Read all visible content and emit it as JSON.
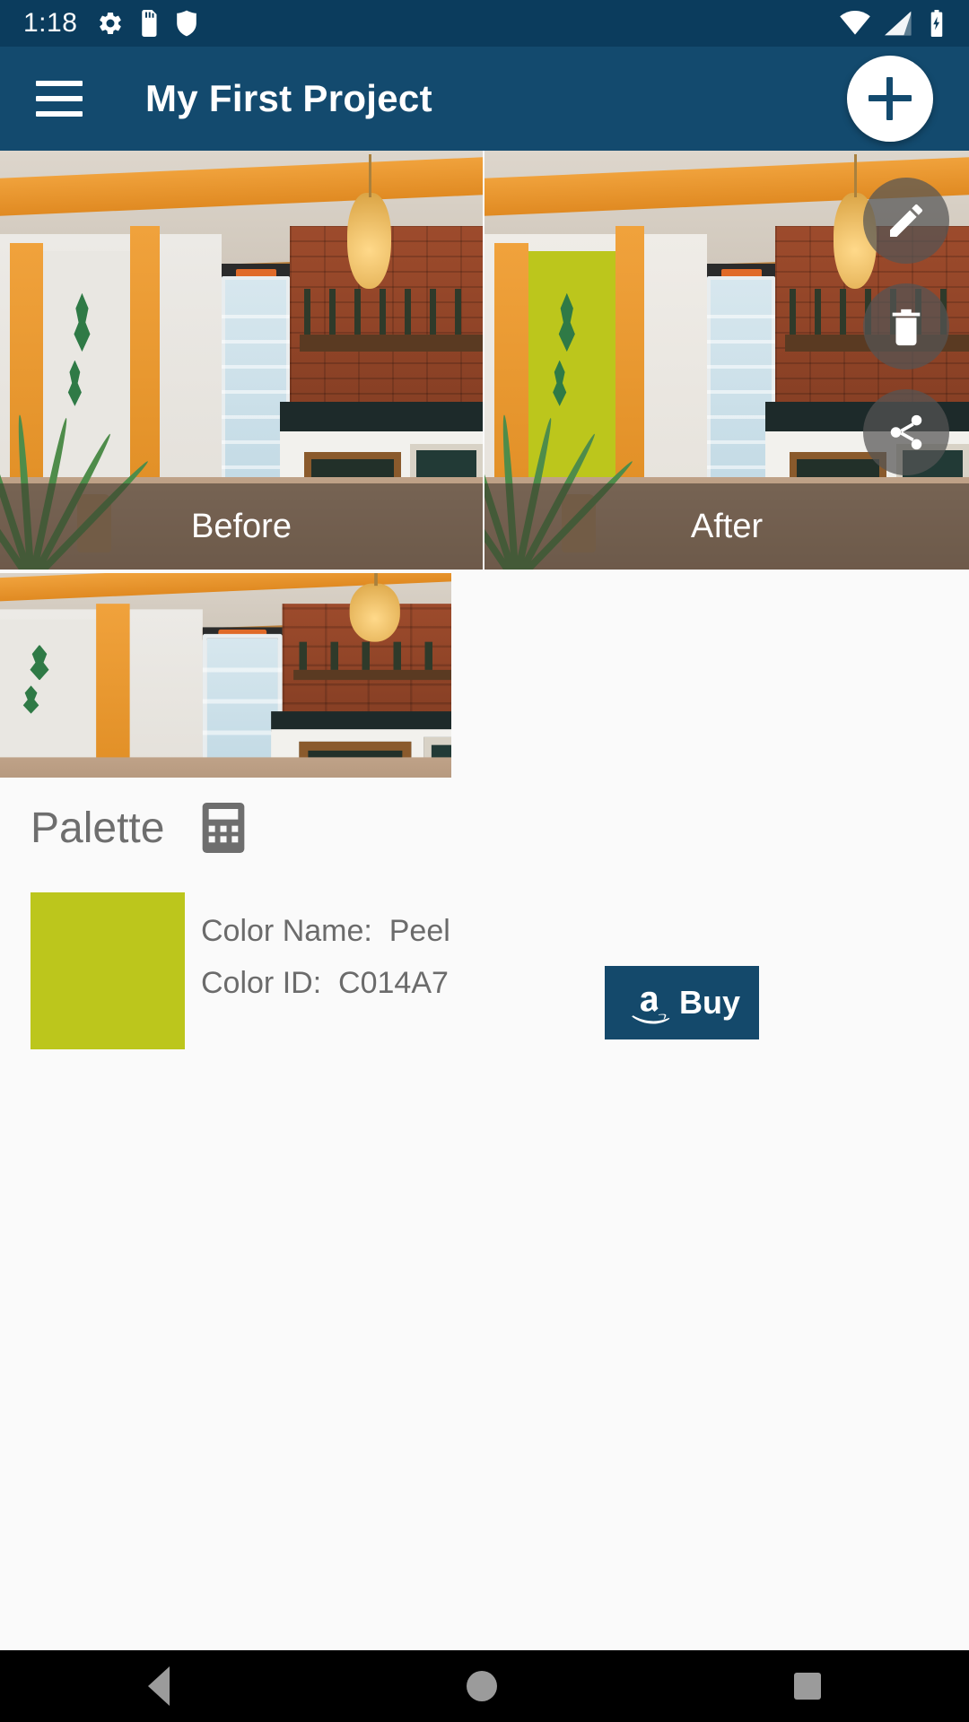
{
  "status_bar": {
    "time": "1:18",
    "left_icons": [
      "gear-icon",
      "sd-card-icon",
      "shield-icon"
    ],
    "right_icons": [
      "wifi-icon",
      "cell-signal-icon",
      "battery-charging-icon"
    ]
  },
  "app_bar": {
    "menu_icon": "hamburger-menu-icon",
    "title": "My First Project",
    "add_button_icon": "plus-icon",
    "background_color": "#134a6e"
  },
  "gallery": {
    "before_label": "Before",
    "after_label": "After",
    "thumbnail_count": 3
  },
  "side_actions": [
    {
      "name": "edit",
      "icon": "pencil-icon"
    },
    {
      "name": "delete",
      "icon": "trash-icon"
    },
    {
      "name": "share",
      "icon": "share-icon"
    }
  ],
  "palette": {
    "title": "Palette",
    "calculator_icon": "calculator-icon",
    "swatch_color": "#bcc61c",
    "color_name_line": "Color Name:  Peel",
    "color_id_line": "Color ID:  C014A7",
    "color_name_label": "Color Name:",
    "color_name_value": "Peel",
    "color_id_label": "Color ID:",
    "color_id_value": "C014A7",
    "buy_button": {
      "label": "Buy",
      "logo_icon": "amazon-logo-icon",
      "background_color": "#14496b"
    }
  },
  "nav_bar": {
    "back_icon": "back-triangle-icon",
    "home_icon": "home-circle-icon",
    "recents_icon": "recents-square-icon"
  }
}
